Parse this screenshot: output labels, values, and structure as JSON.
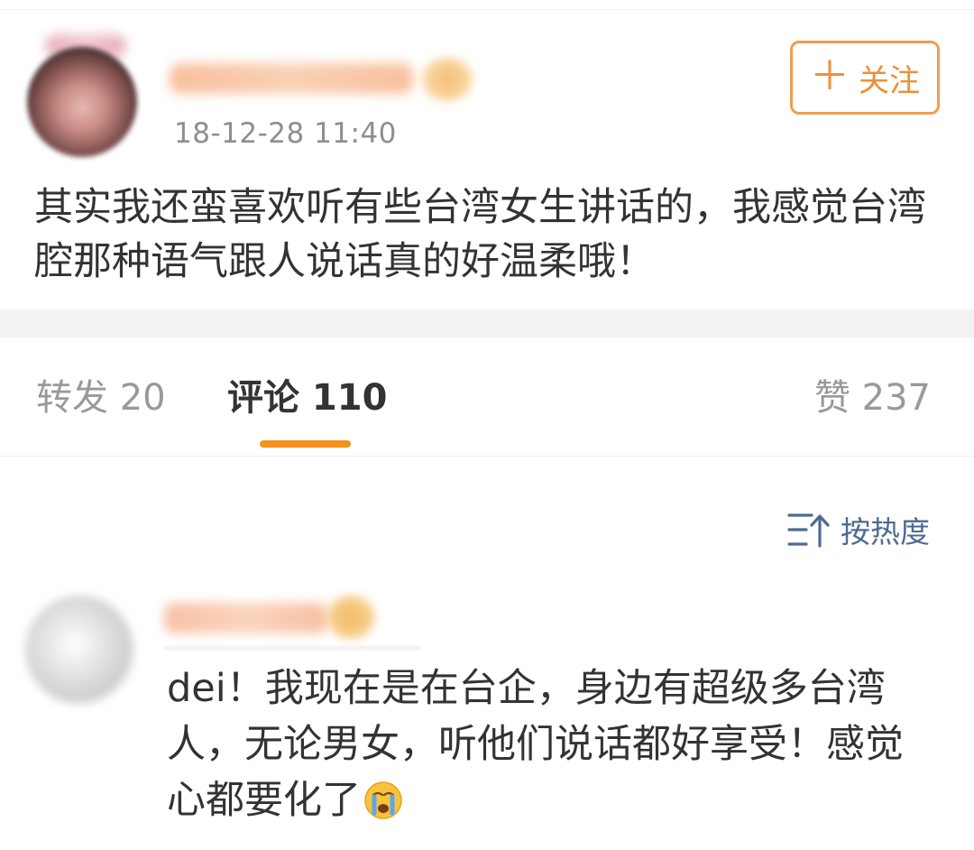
{
  "post": {
    "timestamp": "18-12-28 11:40",
    "follow_label": "关注",
    "follow_icon": "plus",
    "text": "其实我还蛮喜欢听有些台湾女生讲话的，我感觉台湾腔那种语气跟人说话真的好温柔哦！"
  },
  "tabs": {
    "repost": "转发 20",
    "comments": "评论 110",
    "likes": "赞 237",
    "active": "comments",
    "indicator_color": "#f6911e"
  },
  "sort": {
    "label": "按热度",
    "icon": "sort-up-icon",
    "color": "#4d6b92"
  },
  "comment": {
    "text": "dei！我现在是在台企，身边有超级多台湾人，无论男女，听他们说话都好享受！感觉心都要化了",
    "emoji": "crying-face-icon"
  },
  "colors": {
    "accent": "#f08f36",
    "text": "#333333",
    "muted": "#999999",
    "separator": "#f2f2f2"
  }
}
